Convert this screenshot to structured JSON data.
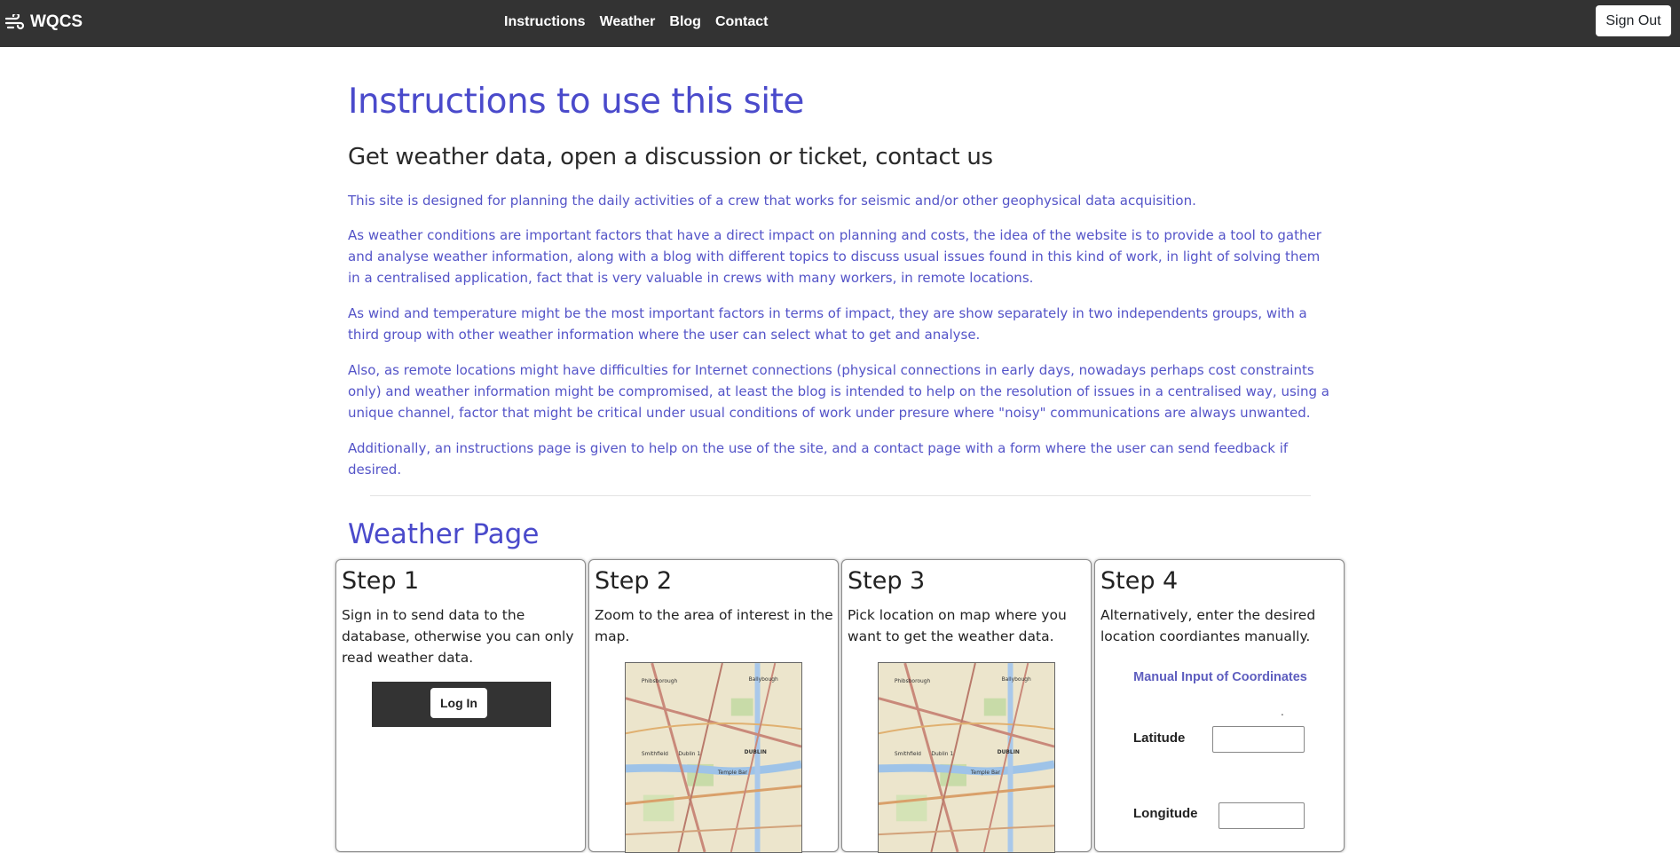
{
  "navbar": {
    "brand": "WQCS",
    "links": [
      "Instructions",
      "Weather",
      "Blog",
      "Contact"
    ],
    "signout_label": "Sign Out"
  },
  "main": {
    "title": "Instructions to use this site",
    "subtitle": "Get weather data, open a discussion or ticket, contact us",
    "paragraphs": [
      "This site is designed for planning the daily activities of a crew that works for seismic and/or other geophysical data acquisition.",
      "As weather conditions are important factors that have a direct impact on planning and costs, the idea of the website is to provide a tool to gather and analyse weather information, along with a blog with different topics to discuss usual issues found in this kind of work, in light of solving them in a centralised application, fact that is very valuable in crews with many workers, in remote locations.",
      "As wind and temperature might be the most important factors in terms of impact, they are show separately in two independents groups, with a third group with other weather information where the user can select what to get and analyse.",
      "Also, as remote locations might have difficulties for Internet connections (physical connections in early days, nowadays perhaps cost constraints only) and weather information might be compromised, at least the blog is intended to help on the resolution of issues in a centralised way, using a unique channel, factor that might be critical under usual conditions of work under presure where \"noisy\" communications are always unwanted.",
      "Additionally, an instructions page is given to help on the use of the site, and a contact page with a form where the user can send feedback if desired."
    ]
  },
  "weather_section": {
    "title": "Weather Page",
    "steps": [
      {
        "title": "Step 1",
        "text": "Sign in to send data to the database, otherwise you can only read weather data.",
        "button": "Log In"
      },
      {
        "title": "Step 2",
        "text": "Zoom to the area of interest in the map."
      },
      {
        "title": "Step 3",
        "text": "Pick location on map where you want to get the weather data."
      },
      {
        "title": "Step 4",
        "text": "Alternatively, enter the desired location coordiantes manually.",
        "form_title": "Manual Input of Coordinates",
        "dot": ".",
        "latitude_label": "Latitude",
        "longitude_label": "Longitude",
        "latitude_value": "",
        "longitude_value": ""
      }
    ]
  },
  "map_labels": [
    "Phibsborough",
    "Ballybough",
    "Smithfield",
    "Dublin 1",
    "DUBLIN",
    "Temple Bar"
  ],
  "colors": {
    "navbar_bg": "#333333",
    "accent": "#4a4acb",
    "paragraph": "#5454c8"
  },
  "icons": {
    "brand": "wind-icon"
  }
}
